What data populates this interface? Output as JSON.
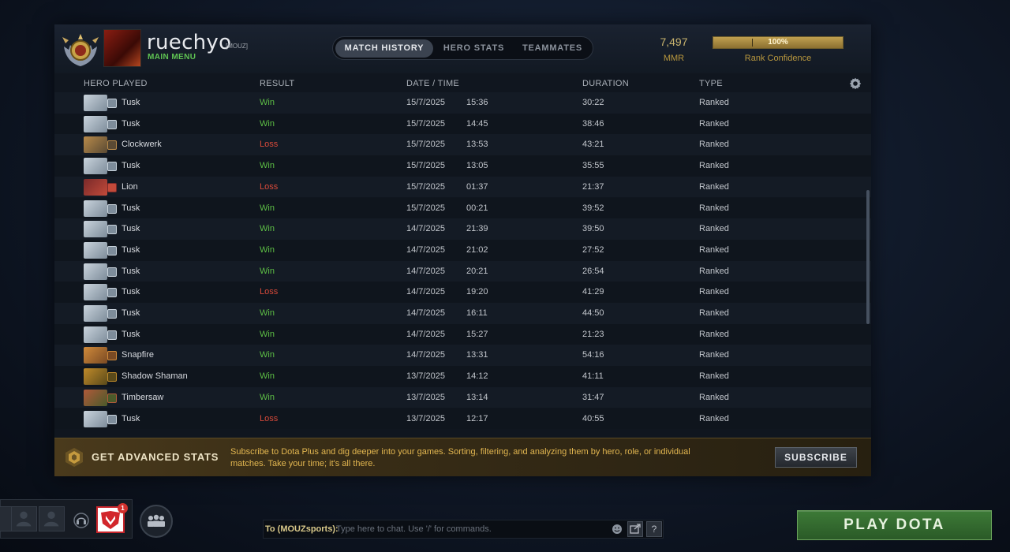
{
  "header": {
    "username": "ruechyo",
    "team_tag": "[MOUZ]",
    "main_menu": "MAIN MENU",
    "tabs": [
      {
        "label": "MATCH HISTORY",
        "active": true
      },
      {
        "label": "HERO STATS",
        "active": false
      },
      {
        "label": "TEAMMATES",
        "active": false
      }
    ],
    "mmr_value": "7,497",
    "mmr_label": "MMR",
    "rank_confidence_value": "100%",
    "rank_confidence_fraction": 1.0,
    "rank_confidence_label": "Rank Confidence"
  },
  "table": {
    "columns": [
      "HERO PLAYED",
      "RESULT",
      "DATE / TIME",
      "DURATION",
      "TYPE"
    ],
    "rows": [
      {
        "hero": "Tusk",
        "result": "Win",
        "date": "15/7/2025",
        "time": "15:36",
        "duration": "30:22",
        "type": "Ranked"
      },
      {
        "hero": "Tusk",
        "result": "Win",
        "date": "15/7/2025",
        "time": "14:45",
        "duration": "38:46",
        "type": "Ranked"
      },
      {
        "hero": "Clockwerk",
        "result": "Loss",
        "date": "15/7/2025",
        "time": "13:53",
        "duration": "43:21",
        "type": "Ranked"
      },
      {
        "hero": "Tusk",
        "result": "Win",
        "date": "15/7/2025",
        "time": "13:05",
        "duration": "35:55",
        "type": "Ranked"
      },
      {
        "hero": "Lion",
        "result": "Loss",
        "date": "15/7/2025",
        "time": "01:37",
        "duration": "21:37",
        "type": "Ranked"
      },
      {
        "hero": "Tusk",
        "result": "Win",
        "date": "15/7/2025",
        "time": "00:21",
        "duration": "39:52",
        "type": "Ranked"
      },
      {
        "hero": "Tusk",
        "result": "Win",
        "date": "14/7/2025",
        "time": "21:39",
        "duration": "39:50",
        "type": "Ranked"
      },
      {
        "hero": "Tusk",
        "result": "Win",
        "date": "14/7/2025",
        "time": "21:02",
        "duration": "27:52",
        "type": "Ranked"
      },
      {
        "hero": "Tusk",
        "result": "Win",
        "date": "14/7/2025",
        "time": "20:21",
        "duration": "26:54",
        "type": "Ranked"
      },
      {
        "hero": "Tusk",
        "result": "Loss",
        "date": "14/7/2025",
        "time": "19:20",
        "duration": "41:29",
        "type": "Ranked"
      },
      {
        "hero": "Tusk",
        "result": "Win",
        "date": "14/7/2025",
        "time": "16:11",
        "duration": "44:50",
        "type": "Ranked"
      },
      {
        "hero": "Tusk",
        "result": "Win",
        "date": "14/7/2025",
        "time": "15:27",
        "duration": "21:23",
        "type": "Ranked"
      },
      {
        "hero": "Snapfire",
        "result": "Win",
        "date": "14/7/2025",
        "time": "13:31",
        "duration": "54:16",
        "type": "Ranked"
      },
      {
        "hero": "Shadow Shaman",
        "result": "Win",
        "date": "13/7/2025",
        "time": "14:12",
        "duration": "41:11",
        "type": "Ranked"
      },
      {
        "hero": "Timbersaw",
        "result": "Win",
        "date": "13/7/2025",
        "time": "13:14",
        "duration": "31:47",
        "type": "Ranked"
      },
      {
        "hero": "Tusk",
        "result": "Loss",
        "date": "13/7/2025",
        "time": "12:17",
        "duration": "40:55",
        "type": "Ranked"
      }
    ]
  },
  "hero_colors": {
    "Tusk": [
      "#c9d3dc",
      "#7d8c9a"
    ],
    "Clockwerk": [
      "#b88a4a",
      "#5a4a34"
    ],
    "Lion": [
      "#7a2a2a",
      "#c24a3a"
    ],
    "Snapfire": [
      "#d08a3a",
      "#7a4a24"
    ],
    "Shadow Shaman": [
      "#c08a2a",
      "#5a4a1a"
    ],
    "Timbersaw": [
      "#b05a3a",
      "#4a5a2a"
    ]
  },
  "result_colors": {
    "Win": "#5dbf45",
    "Loss": "#d84a3a"
  },
  "promo": {
    "title": "GET ADVANCED STATS",
    "description": "Subscribe to Dota Plus and dig deeper into your games. Sorting, filtering, and analyzing them by hero, role, or individual matches. Take your time; it's all there.",
    "button": "SUBSCRIBE"
  },
  "footer": {
    "notification_count": "1",
    "chat_to": "To (MOUZsports):",
    "chat_placeholder": "Type here to chat. Use '/' for commands.",
    "help_label": "?",
    "play_button": "PLAY DOTA"
  }
}
